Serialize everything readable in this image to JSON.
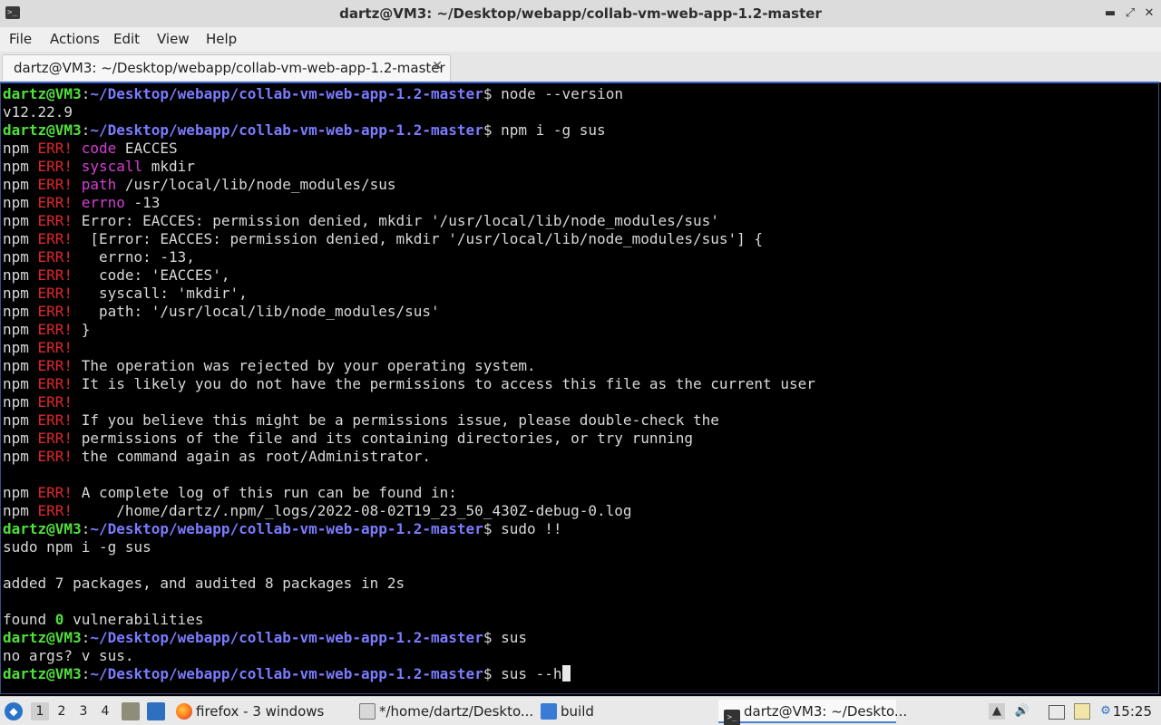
{
  "window": {
    "title": "dartz@VM3: ~/Desktop/webapp/collab-vm-web-app-1.2-master",
    "controls": {
      "minimize": "▬",
      "maximize": "⤢",
      "close": "✕"
    }
  },
  "menu": [
    "File",
    "Actions",
    "Edit",
    "View",
    "Help"
  ],
  "tab": {
    "label": "dartz@VM3: ~/Desktop/webapp/collab-vm-web-app-1.2-master",
    "close": "✕"
  },
  "terminal": {
    "user_host": "dartz@VM3",
    "path": "~/Desktop/webapp/collab-vm-web-app-1.2-master",
    "lines": [
      {
        "type": "prompt",
        "cmd": "node --version"
      },
      {
        "type": "out",
        "text": "v12.22.9"
      },
      {
        "type": "prompt",
        "cmd": "npm i -g sus"
      },
      {
        "type": "err",
        "kw": "code",
        "text": " EACCES"
      },
      {
        "type": "err",
        "kw": "syscall",
        "text": " mkdir"
      },
      {
        "type": "err",
        "kw": "path",
        "text": " /usr/local/lib/node_modules/sus"
      },
      {
        "type": "err",
        "kw": "errno",
        "text": " -13"
      },
      {
        "type": "err",
        "text": " Error: EACCES: permission denied, mkdir '/usr/local/lib/node_modules/sus'"
      },
      {
        "type": "err",
        "text": "  [Error: EACCES: permission denied, mkdir '/usr/local/lib/node_modules/sus'] {"
      },
      {
        "type": "err",
        "text": "   errno: -13,"
      },
      {
        "type": "err",
        "text": "   code: 'EACCES',"
      },
      {
        "type": "err",
        "text": "   syscall: 'mkdir',"
      },
      {
        "type": "err",
        "text": "   path: '/usr/local/lib/node_modules/sus'"
      },
      {
        "type": "err",
        "text": " }"
      },
      {
        "type": "err",
        "text": ""
      },
      {
        "type": "err",
        "text": " The operation was rejected by your operating system."
      },
      {
        "type": "err",
        "text": " It is likely you do not have the permissions to access this file as the current user"
      },
      {
        "type": "err",
        "text": ""
      },
      {
        "type": "err",
        "text": " If you believe this might be a permissions issue, please double-check the"
      },
      {
        "type": "err",
        "text": " permissions of the file and its containing directories, or try running"
      },
      {
        "type": "err",
        "text": " the command again as root/Administrator."
      },
      {
        "type": "out",
        "text": ""
      },
      {
        "type": "err",
        "text": " A complete log of this run can be found in:"
      },
      {
        "type": "err",
        "text": "     /home/dartz/.npm/_logs/2022-08-02T19_23_50_430Z-debug-0.log"
      },
      {
        "type": "prompt",
        "cmd": "sudo !!"
      },
      {
        "type": "out",
        "text": "sudo npm i -g sus"
      },
      {
        "type": "out",
        "text": ""
      },
      {
        "type": "out",
        "text": "added 7 packages, and audited 8 packages in 2s"
      },
      {
        "type": "out",
        "text": ""
      },
      {
        "type": "found",
        "pre": "found ",
        "num": "0",
        "post": " vulnerabilities"
      },
      {
        "type": "prompt",
        "cmd": "sus"
      },
      {
        "type": "out",
        "text": "no args? v sus."
      },
      {
        "type": "prompt",
        "cmd": "sus --h",
        "cursor": true
      }
    ]
  },
  "taskbar": {
    "workspaces": [
      "1",
      "2",
      "3",
      "4"
    ],
    "active_workspace": "1",
    "tasks": [
      {
        "label": "firefox - 3 windows",
        "icon": "firefox-icon"
      },
      {
        "label": "*/home/dartz/Deskto...",
        "icon": "text-editor-icon"
      },
      {
        "label": "build",
        "icon": "folder-icon"
      },
      {
        "label": "dartz@VM3: ~/Deskto...",
        "icon": "terminal-icon",
        "active": true
      }
    ],
    "clock": "15:25"
  }
}
